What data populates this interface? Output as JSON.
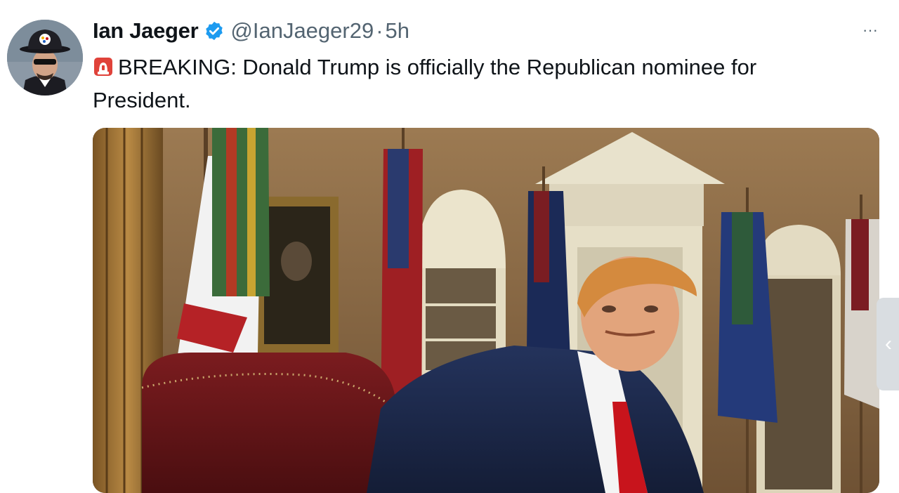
{
  "tweet": {
    "author_name": "Ian Jaeger",
    "author_handle": "@IanJaeger29",
    "separator": "·",
    "time_ago": "5h",
    "verified": true,
    "more_label": "···",
    "text": "BREAKING: Donald Trump is officially the Republican nominee for President.",
    "emoji_icon": "rotating-light-icon",
    "media_description_icon": "photo"
  },
  "side_panel": {
    "toggle_label": "‹"
  },
  "colors": {
    "text_primary": "#0f1419",
    "text_secondary": "#536471",
    "verified_blue": "#1d9bf0",
    "tie_red": "#c8141c",
    "suit_navy": "#1c2a4f"
  }
}
